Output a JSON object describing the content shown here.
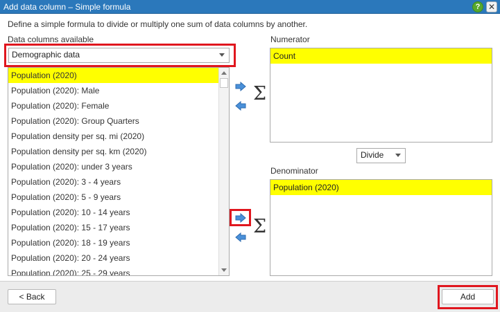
{
  "window": {
    "title": "Add data column – Simple formula",
    "help_label": "?",
    "close_label": "✕"
  },
  "description": "Define a simple formula to divide or multiply one sum of data columns by another.",
  "available": {
    "label": "Data columns available",
    "category": "Demographic data",
    "items": [
      "Population (2020)",
      "Population (2020): Male",
      "Population (2020): Female",
      "Population (2020): Group Quarters",
      "Population density per sq. mi (2020)",
      "Population density per sq. km (2020)",
      "Population (2020): under 3 years",
      "Population (2020): 3 - 4 years",
      "Population (2020): 5 - 9 years",
      "Population (2020): 10 - 14 years",
      "Population (2020): 15 - 17 years",
      "Population (2020): 18 - 19 years",
      "Population (2020): 20 - 24 years",
      "Population (2020): 25 - 29 years"
    ],
    "selected_index": 0
  },
  "numerator": {
    "label": "Numerator",
    "items": [
      "Count"
    ]
  },
  "operator": {
    "value": "Divide"
  },
  "denominator": {
    "label": "Denominator",
    "items": [
      "Population (2020)"
    ]
  },
  "sigma_symbol": "Σ",
  "footer": {
    "back_label": "< Back",
    "add_label": "Add"
  },
  "colors": {
    "titlebar": "#2b78bb",
    "selection": "#ffff00",
    "highlight": "#e0161e",
    "arrow": "#4a90d9"
  },
  "icons": {
    "add_arrow": "right-arrow-icon",
    "remove_arrow": "left-arrow-icon"
  }
}
